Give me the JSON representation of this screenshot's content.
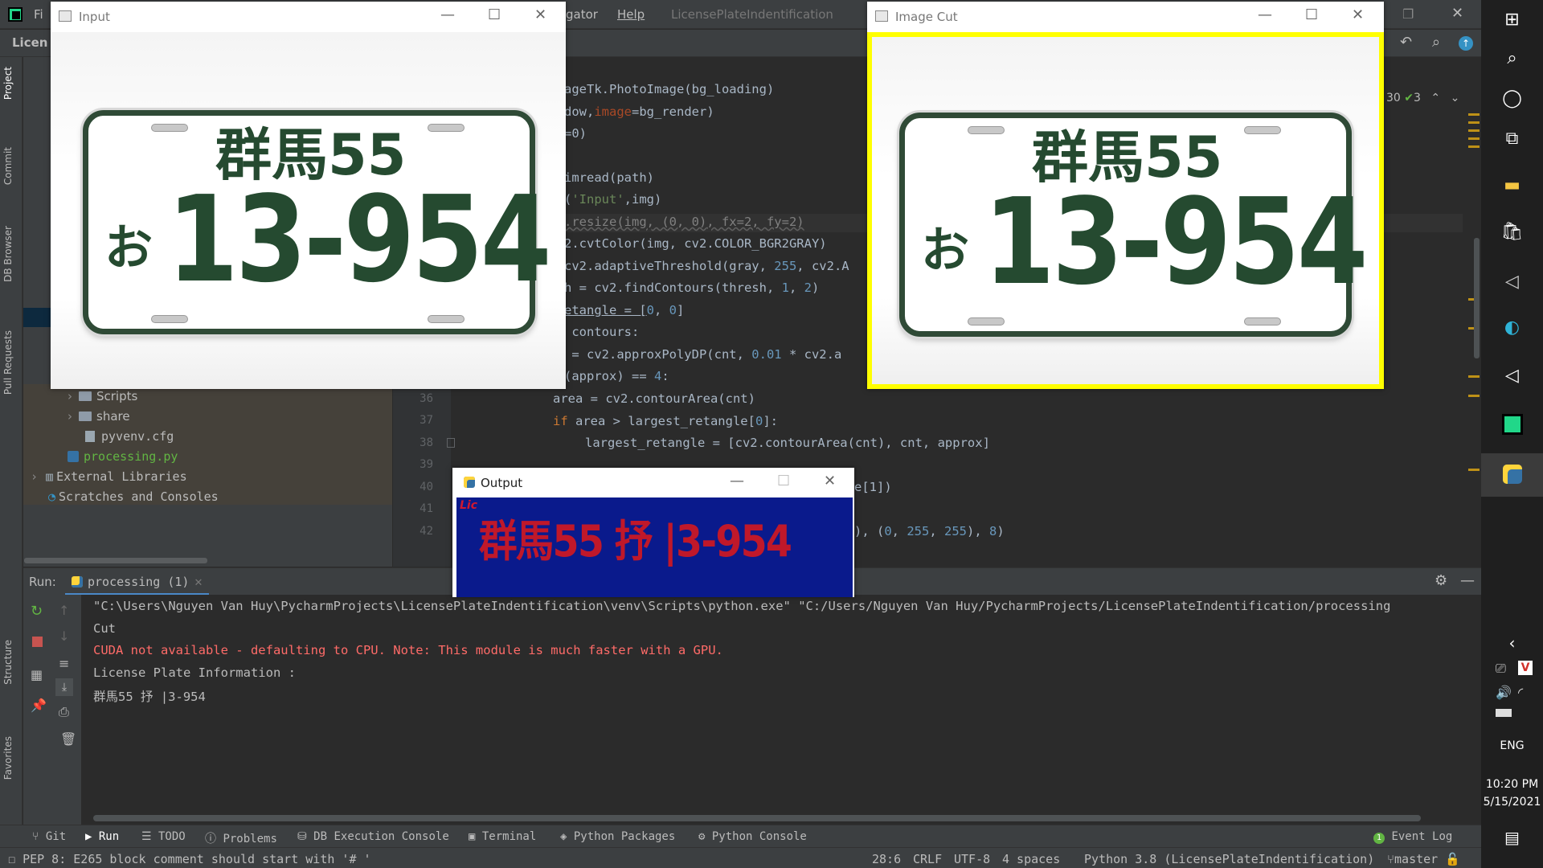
{
  "ide": {
    "menu_right": "gator",
    "menu_help": "Help",
    "project_title": "LicensePlateIndentification",
    "nav_project": "Licen",
    "menu_file": "Fi",
    "inspection_count": "30",
    "check_count": "3"
  },
  "left_strip": {
    "project": "Project",
    "commit": "Commit",
    "db_browser": "DB Browser",
    "pull_requests": "Pull Requests",
    "structure": "Structure",
    "favorites": "Favorites"
  },
  "project_tree": {
    "items": [
      {
        "label": "Scripts",
        "type": "folder"
      },
      {
        "label": "share",
        "type": "folder"
      },
      {
        "label": "pyvenv.cfg",
        "type": "file"
      },
      {
        "label": "processing.py",
        "type": "pyfile"
      },
      {
        "label": "External Libraries",
        "type": "lib"
      },
      {
        "label": "Scratches and Consoles",
        "type": "scratch"
      }
    ]
  },
  "editor": {
    "line_numbers": [
      "36",
      "37",
      "38",
      "39",
      "40",
      "41",
      "42"
    ],
    "lines": {
      "l1a": "ageTk.PhotoImage(bg_loading)",
      "l2a": "dow,",
      "l2b": "image",
      "l2c": "=bg_render)",
      "l3a": "=0)",
      "l5a": "imread(path)",
      "l6a": "(",
      "l6b": "'Input'",
      "l6c": ",img)",
      "l7a": ".resize(img, (0, 0), fx=2, fy=2)",
      "l8a": "2.cvtColor(img, cv2.COLOR_BGR2GRAY)",
      "l9a": "cv2.adaptiveThreshold(gray, ",
      "l9b": "255",
      "l9c": ", cv2.A",
      "l10a": "h = cv2.findContours(thresh, ",
      "l10b": "1",
      "l10c": ", ",
      "l10d": "2",
      "l10e": ")",
      "l11a": "etangle = [",
      "l11b": "0",
      "l11c": ", ",
      "l11d": "0",
      "l11e": "]",
      "l12a": " contours:",
      "l13a": " = cv2.approxPolyDP(cnt, ",
      "l13b": "0.01",
      "l13c": " * cv2.a",
      "l14a": "(approx) == ",
      "l14b": "4",
      "l14c": ":",
      "l36": "area = cv2.contourArea(cnt)",
      "l37a": "if",
      "l37b": " area > largest_retangle[",
      "l37c": "0",
      "l37d": "]:",
      "l38": "largest_retangle = [cv2.contourArea(cnt), cnt, approx]",
      "l40": "e[1])",
      "l42a": "), (",
      "l42b": "0",
      "l42c": ", ",
      "l42d": "255",
      "l42e": ", ",
      "l42f": "255",
      "l42g": "), ",
      "l42h": "8",
      "l42i": ")"
    }
  },
  "run": {
    "label": "Run:",
    "tab": "processing (1)",
    "console": [
      "\"C:\\Users\\Nguyen Van Huy\\PycharmProjects\\LicensePlateIndentification\\venv\\Scripts\\python.exe\" \"C:/Users/Nguyen Van Huy/PycharmProjects/LicensePlateIndentification/processing",
      "Cut",
      "CUDA not available - defaulting to CPU. Note: This module is much faster with a GPU.",
      "License Plate Information :",
      "群馬55 抒 |3-954"
    ]
  },
  "bottom_tabs": [
    "Git",
    "Run",
    "TODO",
    "Problems",
    "DB Execution Console",
    "Terminal",
    "Python Packages",
    "Python Console"
  ],
  "event_log": "Event Log",
  "status": {
    "message": "PEP 8: E265 block comment should start with '# '",
    "position": "28:6",
    "line_sep": "CRLF",
    "encoding": "UTF-8",
    "indent": "4 spaces",
    "interpreter": "Python 3.8 (LicensePlateIndentification)",
    "branch": "master"
  },
  "windows": {
    "input_title": "Input",
    "imagecut_title": "Image Cut",
    "output_title": "Output",
    "output_text": "群馬55 抒 |3-954",
    "output_logo": "Lic"
  },
  "plate": {
    "top": "群馬55",
    "kana": "お",
    "number": "13-954"
  },
  "taskbar": {
    "lang": "ENG",
    "time": "10:20 PM",
    "date": "5/15/2021"
  },
  "colors": {
    "accent_yellow": "#ffff00",
    "output_bg": "#0a1a8c",
    "output_text": "#c0182a",
    "plate_green": "#254a30",
    "error_red": "#ff6b68"
  }
}
